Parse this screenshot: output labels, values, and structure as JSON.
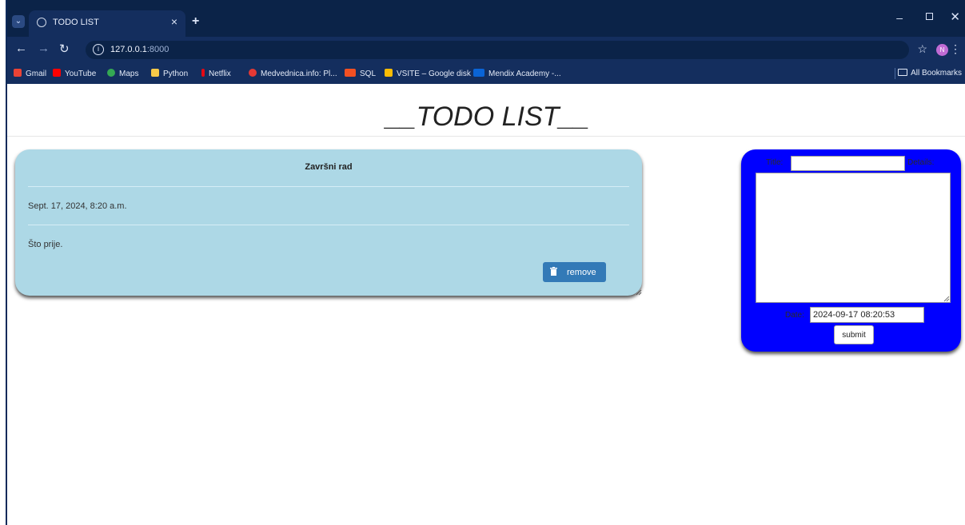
{
  "browser": {
    "tab_title": "TODO LIST",
    "url_host": "127.0.0.1",
    "url_port": ":8000",
    "bookmarks": [
      {
        "label": "Gmail",
        "color": "#ea4335"
      },
      {
        "label": "YouTube",
        "color": "#ff0000"
      },
      {
        "label": "Maps",
        "color": "#34a853"
      },
      {
        "label": "Python",
        "color": "#f7c948"
      },
      {
        "label": "Netflix",
        "color": "#e50914"
      },
      {
        "label": "Medvednica.info: Pl...",
        "color": "#e53935"
      },
      {
        "label": "SQL",
        "color": "#f25022"
      },
      {
        "label": "VSITE – Google disk",
        "color": "#fbbc04"
      },
      {
        "label": "Mendix Academy -...",
        "color": "#0a64d6"
      }
    ],
    "all_bookmarks": "All Bookmarks",
    "profile_initial": "N"
  },
  "page": {
    "title": "__TODO LIST__"
  },
  "todo": {
    "title": "Završni rad",
    "date": "Sept. 17, 2024, 8:20 a.m.",
    "details": "Što prije.",
    "remove_label": "remove"
  },
  "form": {
    "title_label": "Title:",
    "details_label": "Details:",
    "date_label": "Date:",
    "date_value": "2024-09-17 08:20:53",
    "submit_label": "submit"
  },
  "colors": {
    "card_bg": "#add8e6",
    "form_bg": "#0000ff",
    "remove_btn": "#337ab7",
    "chrome": "#142e5e"
  }
}
